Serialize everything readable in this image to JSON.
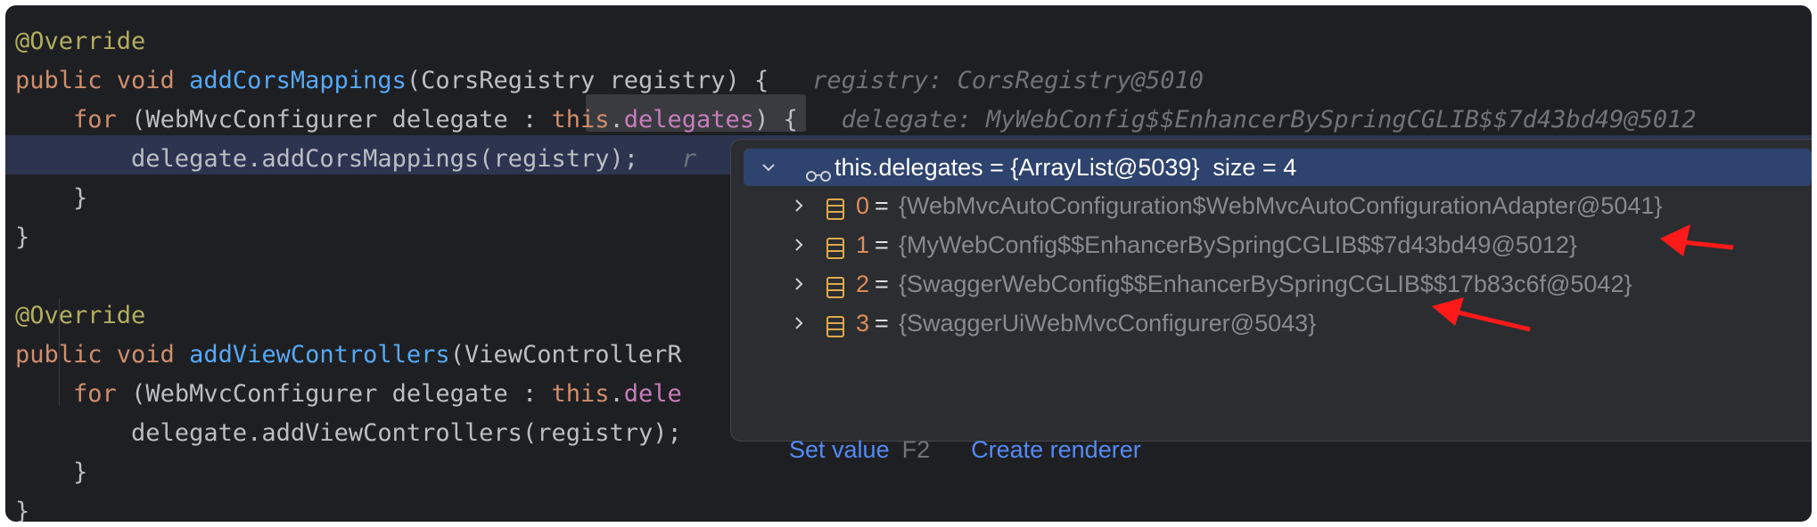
{
  "code": {
    "lines": [
      {
        "tokens": [
          {
            "c": "ann",
            "t": "@Override"
          }
        ]
      },
      {
        "tokens": [
          {
            "c": "kw",
            "t": "public void "
          },
          {
            "c": "fn",
            "t": "addCorsMappings"
          },
          {
            "c": "",
            "t": "(CorsRegistry registry) {"
          },
          {
            "c": "hint",
            "t": "   registry: CorsRegistry@5010"
          }
        ]
      },
      {
        "tokens": [
          {
            "c": "",
            "t": "    "
          },
          {
            "c": "kw",
            "t": "for "
          },
          {
            "c": "",
            "t": "(WebMvcConfigurer delegate : "
          },
          {
            "c": "kw",
            "t": "this"
          },
          {
            "c": "",
            "t": "."
          },
          {
            "c": "fld",
            "t": "delegates"
          },
          {
            "c": "",
            "t": ") {"
          },
          {
            "c": "hint",
            "t": "   delegate: MyWebConfig$$EnhancerBySpringCGLIB$$7d43bd49@5012"
          }
        ]
      },
      {
        "tokens": [
          {
            "c": "",
            "t": "        delegate.addCorsMappings(registry);   "
          },
          {
            "c": "hint",
            "t": "r"
          }
        ]
      },
      {
        "tokens": [
          {
            "c": "",
            "t": "    }"
          }
        ]
      },
      {
        "tokens": [
          {
            "c": "",
            "t": "}"
          }
        ]
      },
      {
        "tokens": []
      },
      {
        "tokens": [
          {
            "c": "ann",
            "t": "@Override"
          }
        ]
      },
      {
        "tokens": [
          {
            "c": "kw",
            "t": "public void "
          },
          {
            "c": "fn",
            "t": "addViewControllers"
          },
          {
            "c": "",
            "t": "(ViewControllerR"
          }
        ]
      },
      {
        "tokens": [
          {
            "c": "",
            "t": "    "
          },
          {
            "c": "kw",
            "t": "for "
          },
          {
            "c": "",
            "t": "(WebMvcConfigurer delegate : "
          },
          {
            "c": "kw",
            "t": "this"
          },
          {
            "c": "",
            "t": "."
          },
          {
            "c": "fld",
            "t": "dele"
          }
        ]
      },
      {
        "tokens": [
          {
            "c": "",
            "t": "        delegate.addViewControllers(registry);"
          }
        ]
      },
      {
        "tokens": [
          {
            "c": "",
            "t": "    }"
          }
        ]
      },
      {
        "tokens": [
          {
            "c": "",
            "t": "}"
          }
        ]
      }
    ]
  },
  "popup": {
    "header": "this.delegates = {ArrayList@5039}  size = 4",
    "items": [
      {
        "index": "0",
        "value": "{WebMvcAutoConfiguration$WebMvcAutoConfigurationAdapter@5041}"
      },
      {
        "index": "1",
        "value": "{MyWebConfig$$EnhancerBySpringCGLIB$$7d43bd49@5012}"
      },
      {
        "index": "2",
        "value": "{SwaggerWebConfig$$EnhancerBySpringCGLIB$$17b83c6f@5042}"
      },
      {
        "index": "3",
        "value": "{SwaggerUiWebMvcConfigurer@5043}"
      }
    ],
    "set_value": "Set value",
    "set_value_key": "F2",
    "create_renderer": "Create renderer"
  },
  "icons": {
    "expand": "chevron-down-icon",
    "collapsed": "chevron-right-icon",
    "watch": "glasses-icon",
    "field": "field-icon"
  },
  "colors": {
    "annotation_arrow": "#ff0000",
    "selection": "#2e436e"
  }
}
